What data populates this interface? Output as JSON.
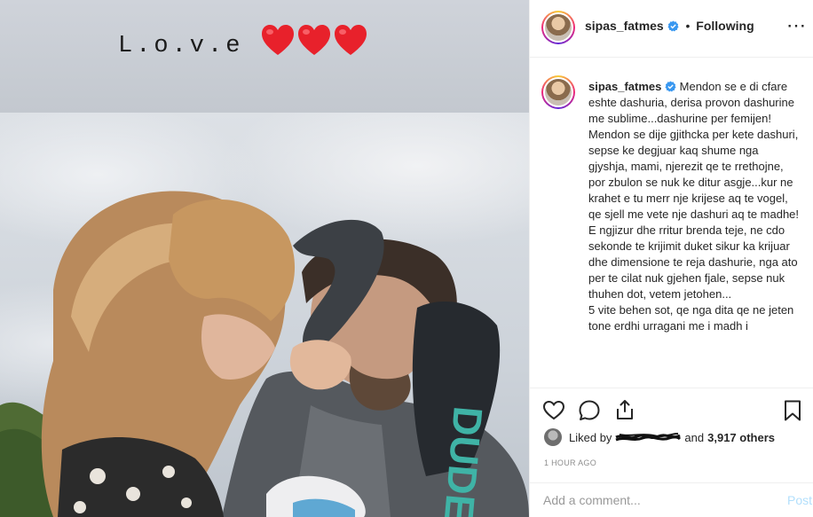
{
  "story": {
    "text": "L.o.v.e",
    "hearts": [
      "heart",
      "heart",
      "heart"
    ],
    "heart_color": "#e8212b"
  },
  "header": {
    "username": "sipas_fatmes",
    "separator": "•",
    "follow_status": "Following",
    "more_icon": "more-options-icon"
  },
  "caption": {
    "username": "sipas_fatmes",
    "paragraphs": [
      "Mendon se e di cfare eshte dashuria, derisa provon dashurine me sublime...dashurine per femijen!",
      "Mendon se dije gjithcka per kete dashuri, sepse ke degjuar kaq shume nga gjyshja, mami, njerezit qe te rrethojne, por zbulon se nuk ke ditur asgje...kur ne krahet e tu merr nje krijese aq te vogel, qe sjell me vete nje dashuri aq te madhe!",
      "E ngjizur dhe rritur brenda teje, ne cdo sekonde te krijimit duket sikur ka krijuar dhe dimensione te reja dashurie, nga ato per te cilat nuk gjehen fjale, sepse nuk thuhen dot, vetem jetohen...",
      "5 vite behen sot, qe nga dita qe ne jeten tone erdhi urragani me i madh i"
    ]
  },
  "actions": {
    "like_icon": "heart-outline-icon",
    "comment_icon": "comment-icon",
    "share_icon": "share-icon",
    "save_icon": "bookmark-icon"
  },
  "likes": {
    "prefix": "Liked by",
    "suffix_and": "and",
    "count": "3,917 others"
  },
  "timestamp": "1 HOUR AGO",
  "comment": {
    "placeholder": "Add a comment...",
    "post_label": "Post"
  },
  "colors": {
    "verified": "#3897f0",
    "post_button_disabled": "#b2dffc",
    "meta_gray": "#8e8e8e"
  }
}
